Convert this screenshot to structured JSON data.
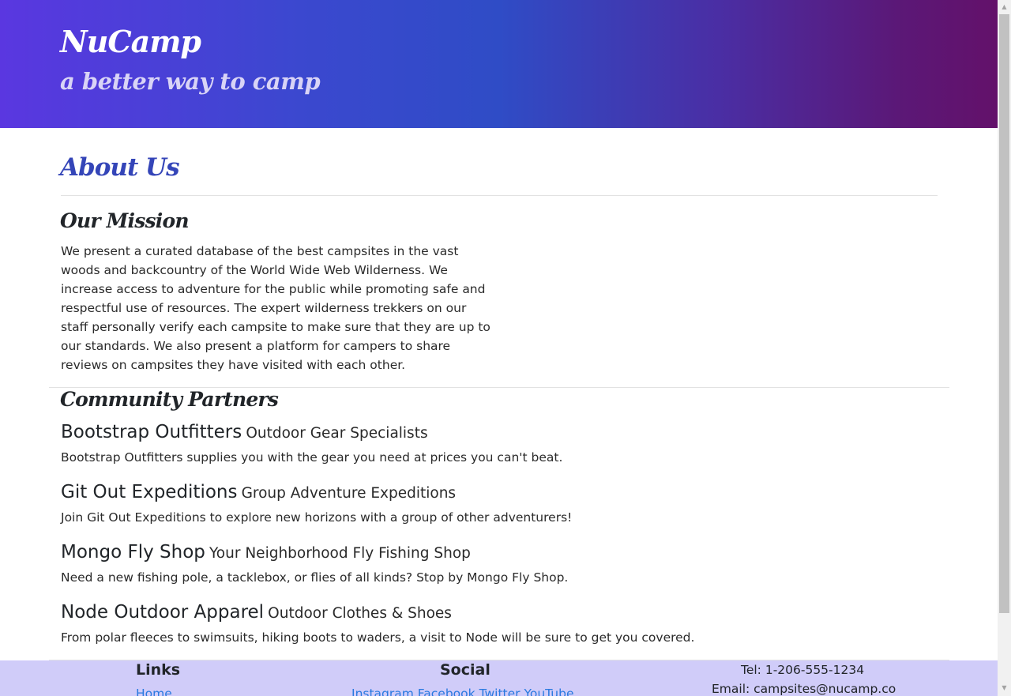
{
  "header": {
    "brand": "NuCamp",
    "tagline": "a better way to camp"
  },
  "page": {
    "title": "About Us"
  },
  "mission": {
    "heading": "Our Mission",
    "text": "We present a curated database of the best campsites in the vast woods and backcountry of the World Wide Web Wilderness. We increase access to adventure for the public while promoting safe and respectful use of resources. The expert wilderness trekkers on our staff personally verify each campsite to make sure that they are up to our standards. We also present a platform for campers to share reviews on campsites they have visited with each other."
  },
  "partners": {
    "heading": "Community Partners",
    "items": [
      {
        "name": "Bootstrap Outfitters",
        "tagline": "Outdoor Gear Specialists",
        "description": "Bootstrap Outfitters supplies you with the gear you need at prices you can't beat."
      },
      {
        "name": "Git Out Expeditions",
        "tagline": "Group Adventure Expeditions",
        "description": "Join Git Out Expeditions to explore new horizons with a group of other adventurers!"
      },
      {
        "name": "Mongo Fly Shop",
        "tagline": "Your Neighborhood Fly Fishing Shop",
        "description": "Need a new fishing pole, a tacklebox, or flies of all kinds? Stop by Mongo Fly Shop."
      },
      {
        "name": "Node Outdoor Apparel",
        "tagline": "Outdoor Clothes & Shoes",
        "description": "From polar fleeces to swimsuits, hiking boots to waders, a visit to Node will be sure to get you covered."
      }
    ]
  },
  "footer": {
    "links_title": "Links",
    "links": [
      "Home"
    ],
    "social_title": "Social",
    "social": [
      "Instagram",
      "Facebook",
      "Twitter",
      "YouTube"
    ],
    "tel": "Tel: 1-206-555-1234",
    "email": "Email: campsites@nucamp.co"
  },
  "icons": {
    "scroll_up": "triangle-up-icon",
    "scroll_down": "triangle-down-icon"
  }
}
